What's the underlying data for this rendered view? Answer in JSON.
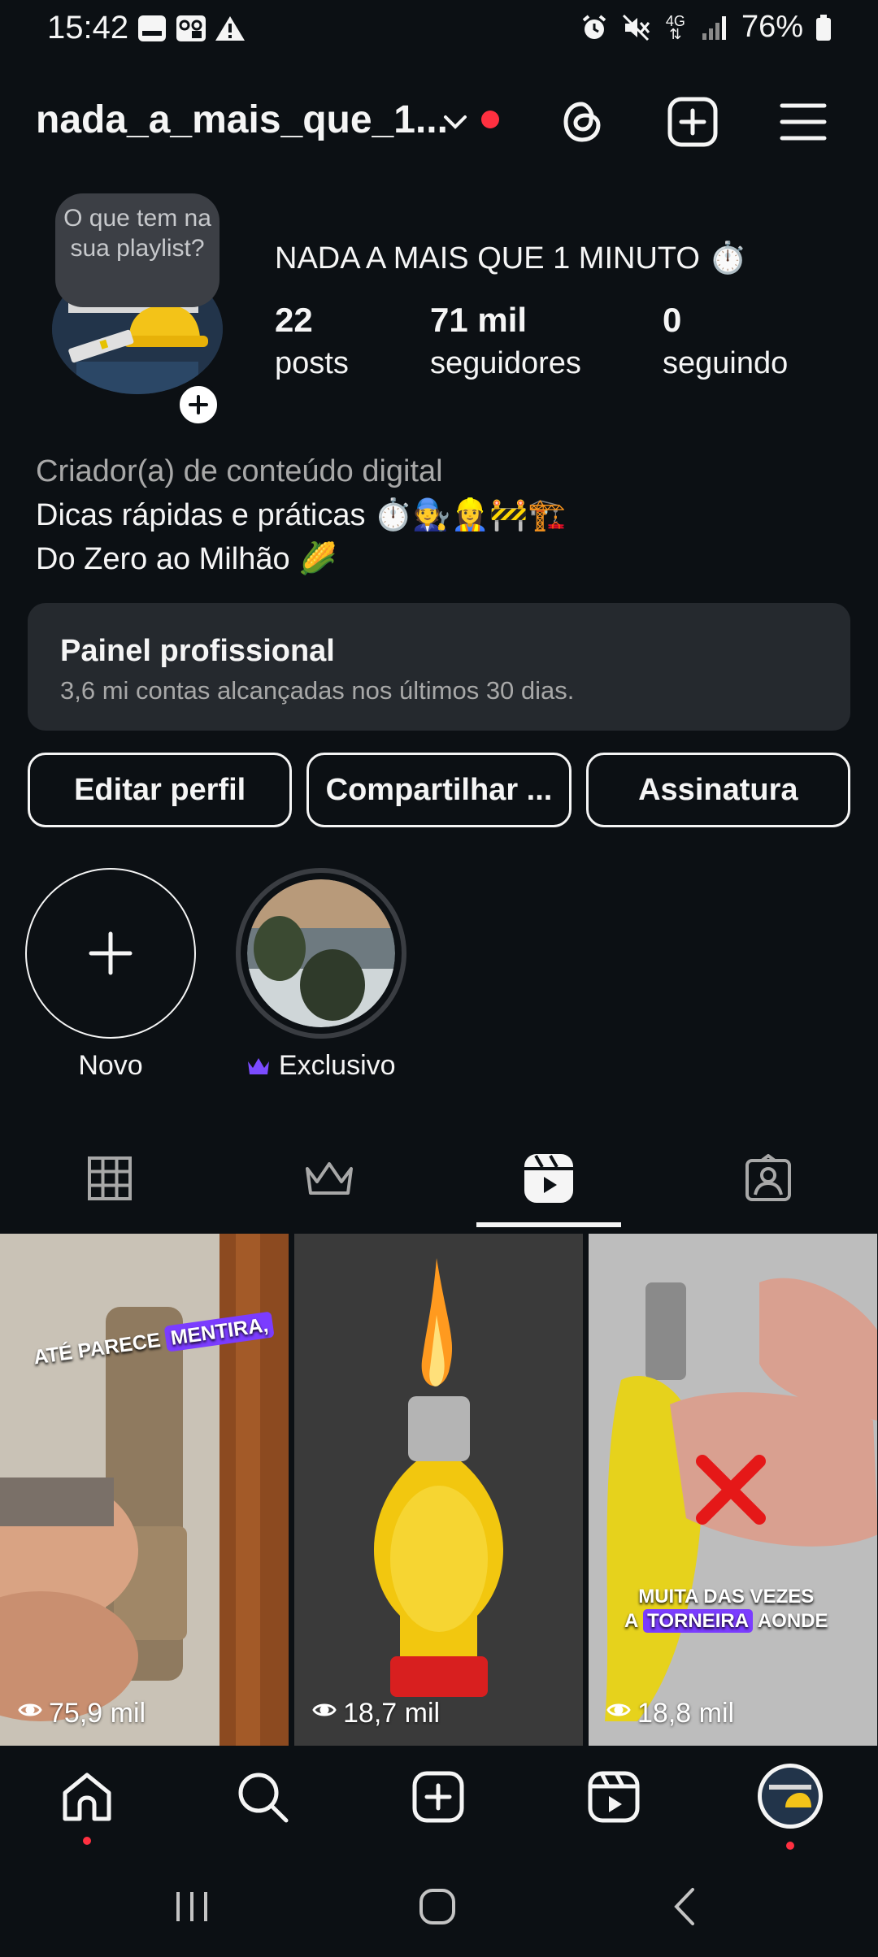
{
  "status_bar": {
    "time": "15:42",
    "battery": "76%",
    "network": "4G"
  },
  "header": {
    "username": "nada_a_mais_que_1...",
    "accent": "#ff3040"
  },
  "profile": {
    "note": "O que tem na sua playlist?",
    "display_name": "NADA A MAIS QUE 1 MINUTO ⏱️",
    "stats": [
      {
        "value": "22",
        "label": "posts"
      },
      {
        "value": "71 mil",
        "label": "seguidores"
      },
      {
        "value": "0",
        "label": "seguindo"
      }
    ],
    "category": "Criador(a) de conteúdo digital",
    "bio_line1": "Dicas rápidas e práticas ⏱️🧑‍🔧👷‍♀️🚧🏗️",
    "bio_line2": "Do Zero ao Milhão 🌽"
  },
  "dashboard": {
    "title": "Painel profissional",
    "subtitle": "3,6 mi contas alcançadas nos últimos 30 dias."
  },
  "actions": {
    "edit": "Editar perfil",
    "share": "Compartilhar ...",
    "subscription": "Assinatura"
  },
  "highlights": [
    {
      "label": "Novo"
    },
    {
      "label": "Exclusivo"
    }
  ],
  "tabs": [
    "grid-icon",
    "crown-icon",
    "reels-icon",
    "tagged-icon"
  ],
  "reels": [
    {
      "views": "75,9 mil",
      "overlay": "ATÉ PARECE MENTIRA,",
      "highlight_word": "MENTIRA,"
    },
    {
      "views": "18,7 mil",
      "overlay": "",
      "highlight_word": ""
    },
    {
      "views": "18,8 mil",
      "overlay_line1": "MUITA DAS VEZES",
      "overlay_line2_pre": "A",
      "overlay_line2_hl": "TORNEIRA",
      "overlay_line2_post": "AONDE"
    }
  ],
  "bottom_nav": [
    "home-icon",
    "search-icon",
    "create-icon",
    "reels-icon",
    "profile-avatar"
  ]
}
